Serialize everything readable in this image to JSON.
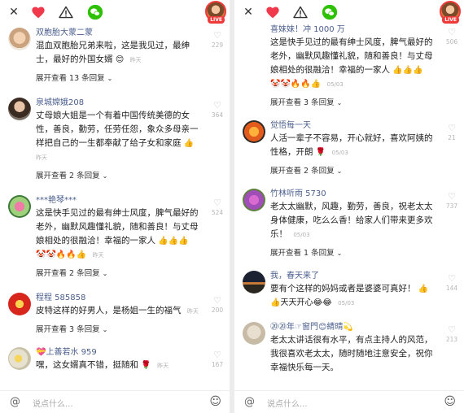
{
  "panels": [
    {
      "icons": {
        "close": "close-icon",
        "heart": "heart-icon",
        "warning": "warning-icon",
        "wechat": "wechat-icon"
      },
      "live_label": "LIVE",
      "comments": [
        {
          "name": "双胞胎大蒙二蒙",
          "lines": [
            "混血双胞胎兄弟来啦，这是我见过，最绅",
            "士，最好的外国女婿"
          ],
          "emoji": "😊",
          "time": "昨天",
          "likes": "229",
          "expand": "展开查看 13 条回复"
        },
        {
          "name": "泉城嫦娥208",
          "lines": [
            "丈母娘大姐是一个有着中国传统美德的女",
            "性，善良，勤劳，任劳任怨，象众多母亲一",
            "样把自己的一生都奉献了给子女和家庭"
          ],
          "emoji": "👍",
          "time": "昨天",
          "likes": "364",
          "expand": "展开查看 2 条回复"
        },
        {
          "name": "***艳琴***",
          "lines": [
            "这是快手见过的最有绅士风度，脾气最好的",
            "老外，幽默风趣懂礼貌，随和善良！与丈母",
            "娘相处的很融洽！幸福的一家人"
          ],
          "emoji": "👍👍👍",
          "emoji_line": "🤡🤡🔥🔥👍",
          "time": "昨天",
          "likes": "524",
          "expand": "展开查看 2 条回复"
        },
        {
          "name": "程程 585858",
          "lines": [
            "皮特这样的好男人，是杨姐一生的福气"
          ],
          "emoji": "",
          "time": "昨天",
          "likes": "200",
          "expand": "展开查看 3 条回复"
        },
        {
          "name": "💝上善若水 959",
          "lines": [
            "嘿，这女婿真不错，挺随和"
          ],
          "emoji": "🌹",
          "time": "昨天",
          "likes": "167",
          "expand": ""
        }
      ],
      "input_placeholder": "说点什么..."
    },
    {
      "icons": {
        "close": "close-icon",
        "heart": "heart-icon",
        "warning": "warning-icon",
        "wechat": "wechat-icon"
      },
      "live_label": "LIVE",
      "comments": [
        {
          "name": "喜妹妹！冲 1000 万",
          "lines": [
            "这是快手见过的最有绅士风度，脾气最好的",
            "老外，幽默风趣懂礼貌，随和善良！与丈母",
            "娘相处的很融洽！幸福的一家人"
          ],
          "emoji": "👍👍👍",
          "emoji_line": "🤡🤡🔥🔥👍",
          "time": "05/03",
          "likes": "506",
          "expand": "展开查看 3 条回复"
        },
        {
          "name": "觉悟每一天",
          "lines": [
            "人活一辈子不容易，开心就好，喜欢阿姨的",
            "性格，开朗"
          ],
          "emoji": "🌹",
          "time": "05/03",
          "likes": "21",
          "expand": "展开查看 2 条回复"
        },
        {
          "name": "竹林听雨 5730",
          "lines": [
            "老太太幽默，风趣，勤劳，善良，祝老太太",
            "身体健康，吃么么香！给家人们带来更多欢",
            "乐！"
          ],
          "emoji": "",
          "time": "05/03",
          "likes": "737",
          "expand": "展开查看 1 条回复"
        },
        {
          "name": "我，春天来了",
          "lines": [
            "要有个这样的妈妈或者是婆婆可真好！"
          ],
          "emoji": "👍",
          "emoji_line": "👍天天开心😂😂",
          "time": "05/03",
          "likes": "144",
          "expand": ""
        },
        {
          "name": "⑳⑳年☞窗門😊綪晴💫",
          "lines": [
            "老太太讲话很有水平，有点主持人的风范，",
            "我很喜欢老太太，随时随地注意安全，祝你",
            "幸福快乐每一天。"
          ],
          "emoji": "",
          "time": "",
          "likes": "213",
          "expand": ""
        }
      ],
      "input_placeholder": "说点什么..."
    }
  ]
}
